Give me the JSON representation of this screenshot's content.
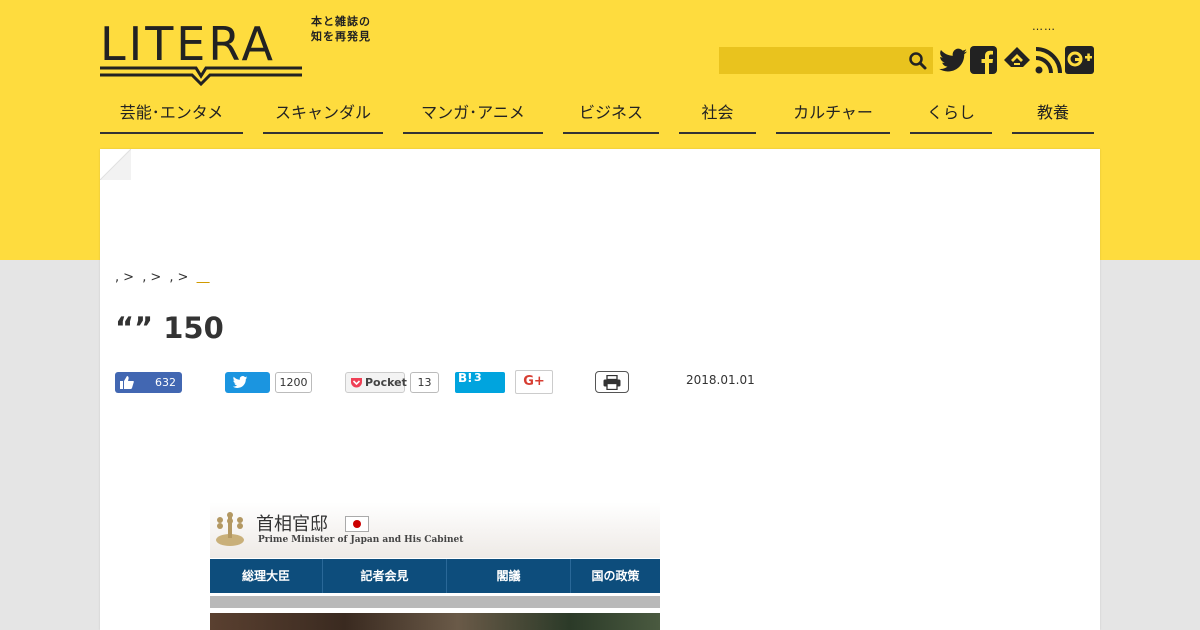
{
  "header": {
    "logo_text": "LITERA",
    "tagline": "本と雑誌の知を再発見",
    "top_link": "……",
    "search": {
      "placeholder": ""
    }
  },
  "social_icons": [
    "twitter-icon",
    "facebook-icon",
    "feedly-icon",
    "rss-icon",
    "google-plus-icon"
  ],
  "nav": {
    "items": [
      {
        "label": "芸能･エンタメ"
      },
      {
        "label": "スキャンダル"
      },
      {
        "label": "マンガ･アニメ"
      },
      {
        "label": "ビジネス"
      },
      {
        "label": "社会"
      },
      {
        "label": "カルチャー"
      },
      {
        "label": "くらし"
      },
      {
        "label": "教養"
      }
    ]
  },
  "breadcrumb": {
    "items": [
      ",",
      ",",
      ","
    ],
    "separator": ">",
    "current": "＿"
  },
  "article": {
    "title": "“” 150",
    "date": "2018.01.01"
  },
  "share": {
    "facebook_count": "632",
    "twitter_count": "1200",
    "pocket_label": "Pocket",
    "pocket_count": "13",
    "hatena_label": "B!",
    "hatena_count": "3",
    "gplus_label": "G+"
  },
  "image": {
    "title": "首相官邸",
    "subtitle": "Prime Minister of Japan and His Cabinet",
    "nav": [
      "総理大臣",
      "記者会見",
      "閣議",
      "国の政策"
    ]
  },
  "colors": {
    "brand_yellow": "#fedc3e",
    "search_bg": "#e9c31e",
    "facebook": "#4267b2",
    "twitter": "#1b95e0",
    "hatena": "#00a4de",
    "gplus": "#d73d32",
    "image_nav": "#0d4d7c"
  }
}
